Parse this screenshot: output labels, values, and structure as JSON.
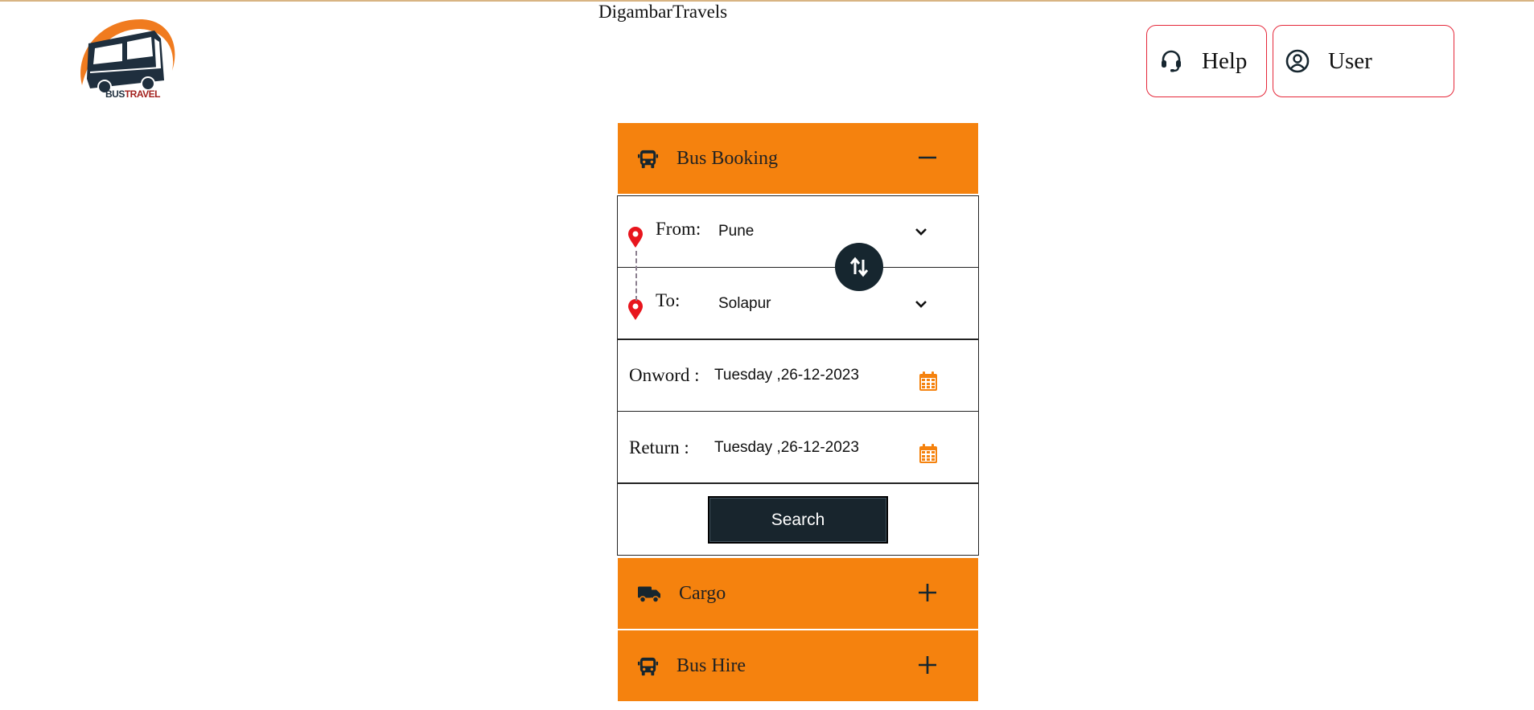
{
  "header": {
    "brand_title": "DigambarTravels",
    "logo_text_part1": "BUS",
    "logo_text_part2": "TRAVEL",
    "help_label": "Help",
    "user_label": "User"
  },
  "booking": {
    "section_title": "Bus Booking",
    "from_label": "From:",
    "from_value": "Pune",
    "to_label": "To:",
    "to_value": "Solapur",
    "onward_label": "Onword :",
    "onward_value": "Tuesday ,26-12-2023",
    "return_label": "Return :",
    "return_value": "Tuesday ,26-12-2023",
    "search_label": "Search"
  },
  "sections": {
    "cargo_title": "Cargo",
    "bus_hire_title": "Bus Hire"
  },
  "colors": {
    "accent_orange": "#f5820e",
    "button_dark": "#18252d",
    "border_red": "#e5283a",
    "pin_red": "#e8151d"
  },
  "icons": {
    "help": "headset-icon",
    "user": "user-circle-icon",
    "bus": "bus-icon",
    "cargo": "truck-icon",
    "collapse": "minus-icon",
    "expand": "plus-icon",
    "location": "map-pin-icon",
    "swap": "swap-arrows-icon",
    "dropdown": "chevron-down-icon",
    "calendar": "calendar-icon"
  }
}
